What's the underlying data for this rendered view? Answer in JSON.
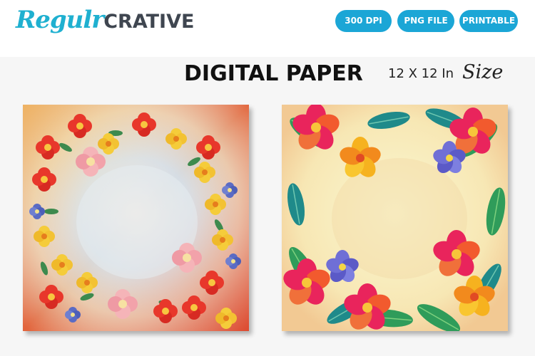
{
  "brand": {
    "script": "Regulr",
    "block": "CRATIVE"
  },
  "badges": [
    "300 DPI",
    "PNG FILE",
    "PRINTABLE"
  ],
  "heading": {
    "title": "DIGITAL PAPER",
    "size_text": "12 X 12 In",
    "size_word": "Size"
  },
  "colors": {
    "accent": "#1ba6d6",
    "logo_script": "#1fb0d0",
    "logo_block": "#3f4650"
  },
  "previews": [
    {
      "name": "watercolor-floral-wreath"
    },
    {
      "name": "tropical-hibiscus-frame"
    }
  ]
}
